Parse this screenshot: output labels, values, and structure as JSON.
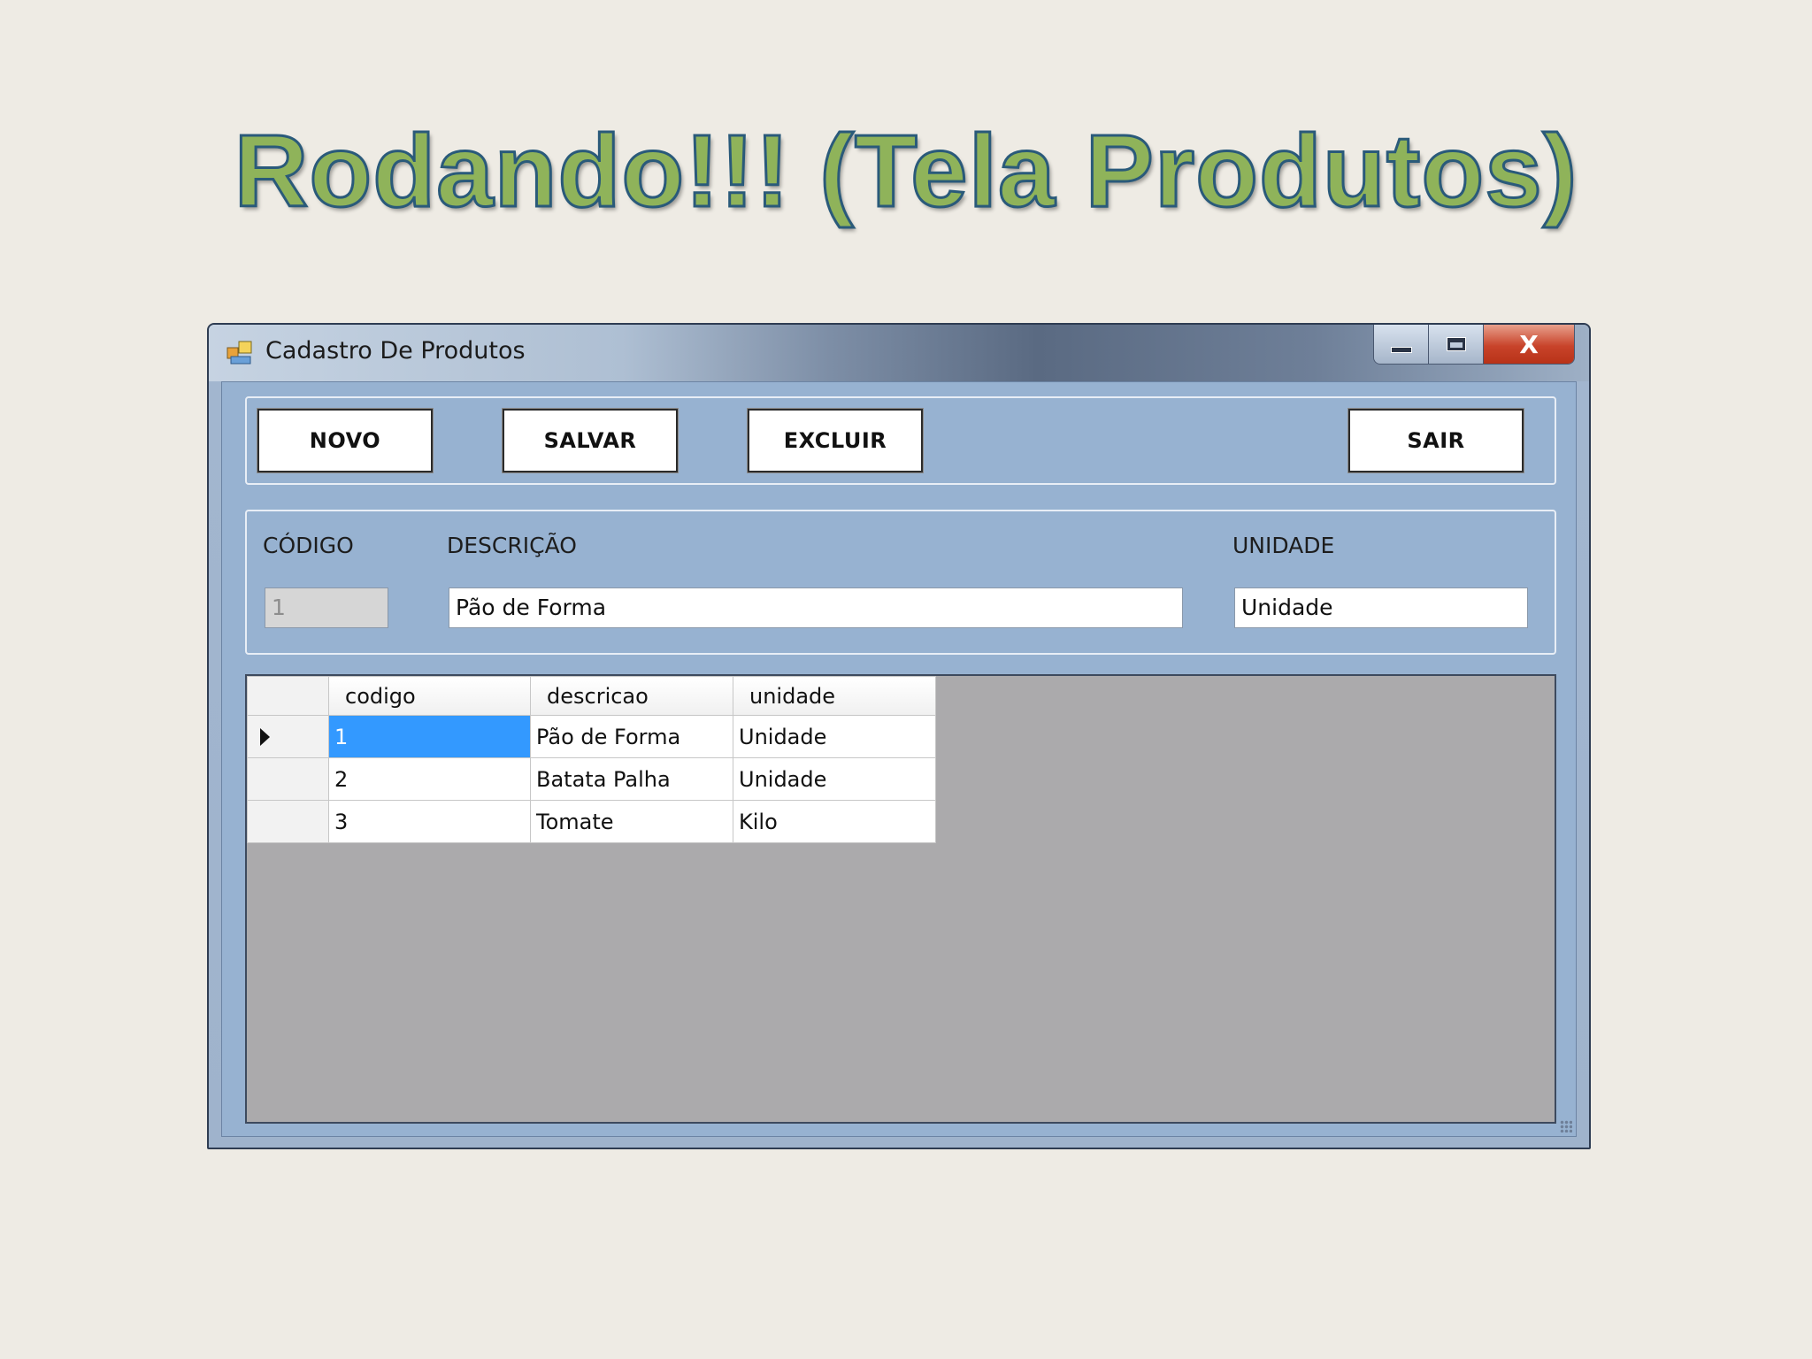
{
  "slide": {
    "title": "Rodando!!! (Tela Produtos)"
  },
  "window": {
    "title": "Cadastro De Produtos",
    "controls": {
      "minimize": "minimize",
      "maximize": "maximize",
      "close": "X"
    }
  },
  "toolbar": {
    "novo": "NOVO",
    "salvar": "SALVAR",
    "excluir": "EXCLUIR",
    "sair": "SAIR"
  },
  "form": {
    "codigo_label": "CÓDIGO",
    "codigo_value": "1",
    "descricao_label": "DESCRIÇÃO",
    "descricao_value": "Pão de Forma",
    "unidade_label": "UNIDADE",
    "unidade_value": "Unidade"
  },
  "grid": {
    "columns": [
      "codigo",
      "descricao",
      "unidade"
    ],
    "rows": [
      {
        "codigo": "1",
        "descricao": "Pão de Forma",
        "unidade": "Unidade",
        "current": true
      },
      {
        "codigo": "2",
        "descricao": "Batata Palha",
        "unidade": "Unidade",
        "current": false
      },
      {
        "codigo": "3",
        "descricao": "Tomate",
        "unidade": "Kilo",
        "current": false
      }
    ]
  },
  "colors": {
    "title_fill": "#8fb35a",
    "title_outline": "#2a5a7a",
    "client_bg": "#97b2d1",
    "selection": "#3399ff",
    "grid_bg": "#abaaac"
  }
}
